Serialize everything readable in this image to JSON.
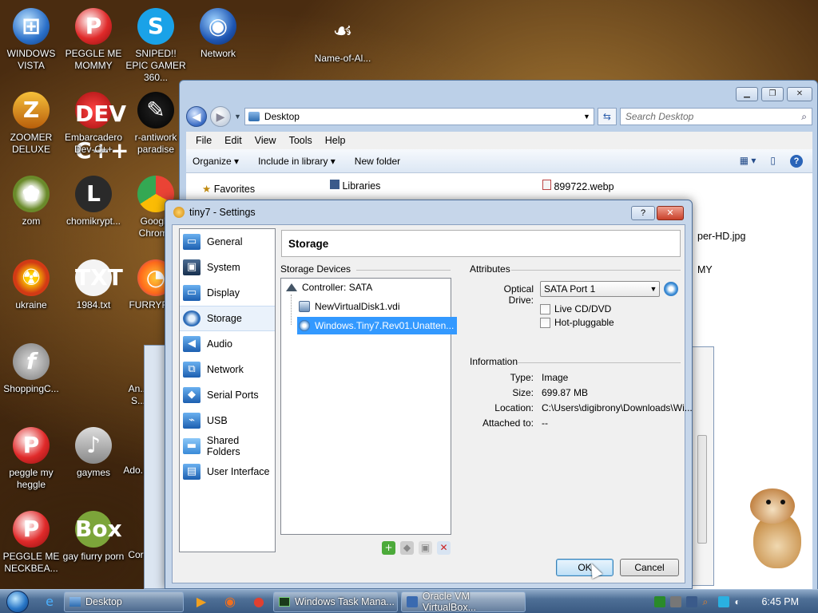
{
  "desktop_icons": [
    {
      "label": "WINDOWS VISTA",
      "icon": "windows-vista-icon",
      "glyph": "⊞"
    },
    {
      "label": "PEGGLE ME MOMMY",
      "icon": "peggle-icon",
      "glyph": "P"
    },
    {
      "label": "SNIPED!! EPIC GAMER 360...",
      "icon": "skype-icon",
      "glyph": "S"
    },
    {
      "label": "Network",
      "icon": "network-globe-icon",
      "glyph": "◉"
    },
    {
      "label": "Name-of-Al...",
      "icon": "calligraphy-icon",
      "glyph": "☙"
    },
    {
      "label": "ZOOMER DELUXE",
      "icon": "zoomer-icon",
      "glyph": "Z"
    },
    {
      "label": "Embarcadero Dev-C++",
      "icon": "devcpp-icon",
      "glyph": "DEV C++"
    },
    {
      "label": "r-antiwork paradise",
      "icon": "antiwork-icon",
      "glyph": "✎"
    },
    {
      "label": "zom",
      "icon": "flower-icon",
      "glyph": "✿"
    },
    {
      "label": "chomikrypt...",
      "icon": "chomikrypt-icon",
      "glyph": "L"
    },
    {
      "label": "Google Chrome",
      "icon": "chrome-icon",
      "glyph": "●"
    },
    {
      "label": "ukraine",
      "icon": "radiation-icon",
      "glyph": "☢"
    },
    {
      "label": "1984.txt",
      "icon": "text-file-icon",
      "glyph": "TXT"
    },
    {
      "label": "FURRYFU...",
      "icon": "firefox-icon",
      "glyph": "◔"
    },
    {
      "label": "ShoppingC...",
      "icon": "flash-icon",
      "glyph": "f"
    },
    {
      "label": "peggle my heggle",
      "icon": "peggle-icon",
      "glyph": "P"
    },
    {
      "label": "gaymes",
      "icon": "gaymes-icon",
      "glyph": "♪"
    },
    {
      "label": "Ado...",
      "icon": "adobe-icon",
      "glyph": ""
    },
    {
      "label": "PEGGLE ME NECKBEA...",
      "icon": "peggle-icon",
      "glyph": "P"
    },
    {
      "label": "gay fiurry porn",
      "icon": "box-icon",
      "glyph": "Box"
    },
    {
      "label": "Cor",
      "icon": "generic-icon",
      "glyph": ""
    },
    {
      "label": "An... S...",
      "icon": "generic-icon",
      "glyph": ""
    }
  ],
  "explorer": {
    "address": "Desktop",
    "search_placeholder": "Search Desktop",
    "menu": [
      "File",
      "Edit",
      "View",
      "Tools",
      "Help"
    ],
    "commands": [
      "Organize ▾",
      "Include in library ▾",
      "New folder"
    ],
    "favorites": "Favorites",
    "libraries": "Libraries",
    "file_webp": "899722.webp",
    "file_jpg_partial": "per-HD.jpg",
    "file_partial_2": "MY"
  },
  "dialog": {
    "title": "tiny7 - Settings",
    "help_btn": "?",
    "categories": [
      {
        "label": "General",
        "icon": "general-icon"
      },
      {
        "label": "System",
        "icon": "system-chip-icon"
      },
      {
        "label": "Display",
        "icon": "display-monitor-icon"
      },
      {
        "label": "Storage",
        "icon": "storage-disk-icon"
      },
      {
        "label": "Audio",
        "icon": "audio-speaker-icon"
      },
      {
        "label": "Network",
        "icon": "network-icon"
      },
      {
        "label": "Serial Ports",
        "icon": "serial-port-icon"
      },
      {
        "label": "USB",
        "icon": "usb-icon"
      },
      {
        "label": "Shared Folders",
        "icon": "shared-folder-icon"
      },
      {
        "label": "User Interface",
        "icon": "user-interface-icon"
      }
    ],
    "selected_category": "Storage",
    "page_title": "Storage",
    "storage_devices_label": "Storage Devices",
    "controller": "Controller: SATA",
    "disks": [
      "NewVirtualDisk1.vdi",
      "Windows.Tiny7.Rev01.Unatten..."
    ],
    "attributes_label": "Attributes",
    "optical_drive_label": "Optical Drive:",
    "optical_drive_value": "SATA Port 1",
    "live_cd": "Live CD/DVD",
    "hot_pluggable": "Hot-pluggable",
    "information_label": "Information",
    "info": [
      {
        "key": "Type:",
        "value": "Image"
      },
      {
        "key": "Size:",
        "value": "699.87 MB"
      },
      {
        "key": "Location:",
        "value": "C:\\Users\\digibrony\\Downloads\\Wi..."
      },
      {
        "key": "Attached to:",
        "value": "--"
      }
    ],
    "ok": "OK",
    "cancel": "Cancel"
  },
  "taskbar": {
    "tasks": [
      "Desktop",
      "Windows Task Mana...",
      "Oracle VM VirtualBox..."
    ],
    "clock": "6:45 PM"
  }
}
